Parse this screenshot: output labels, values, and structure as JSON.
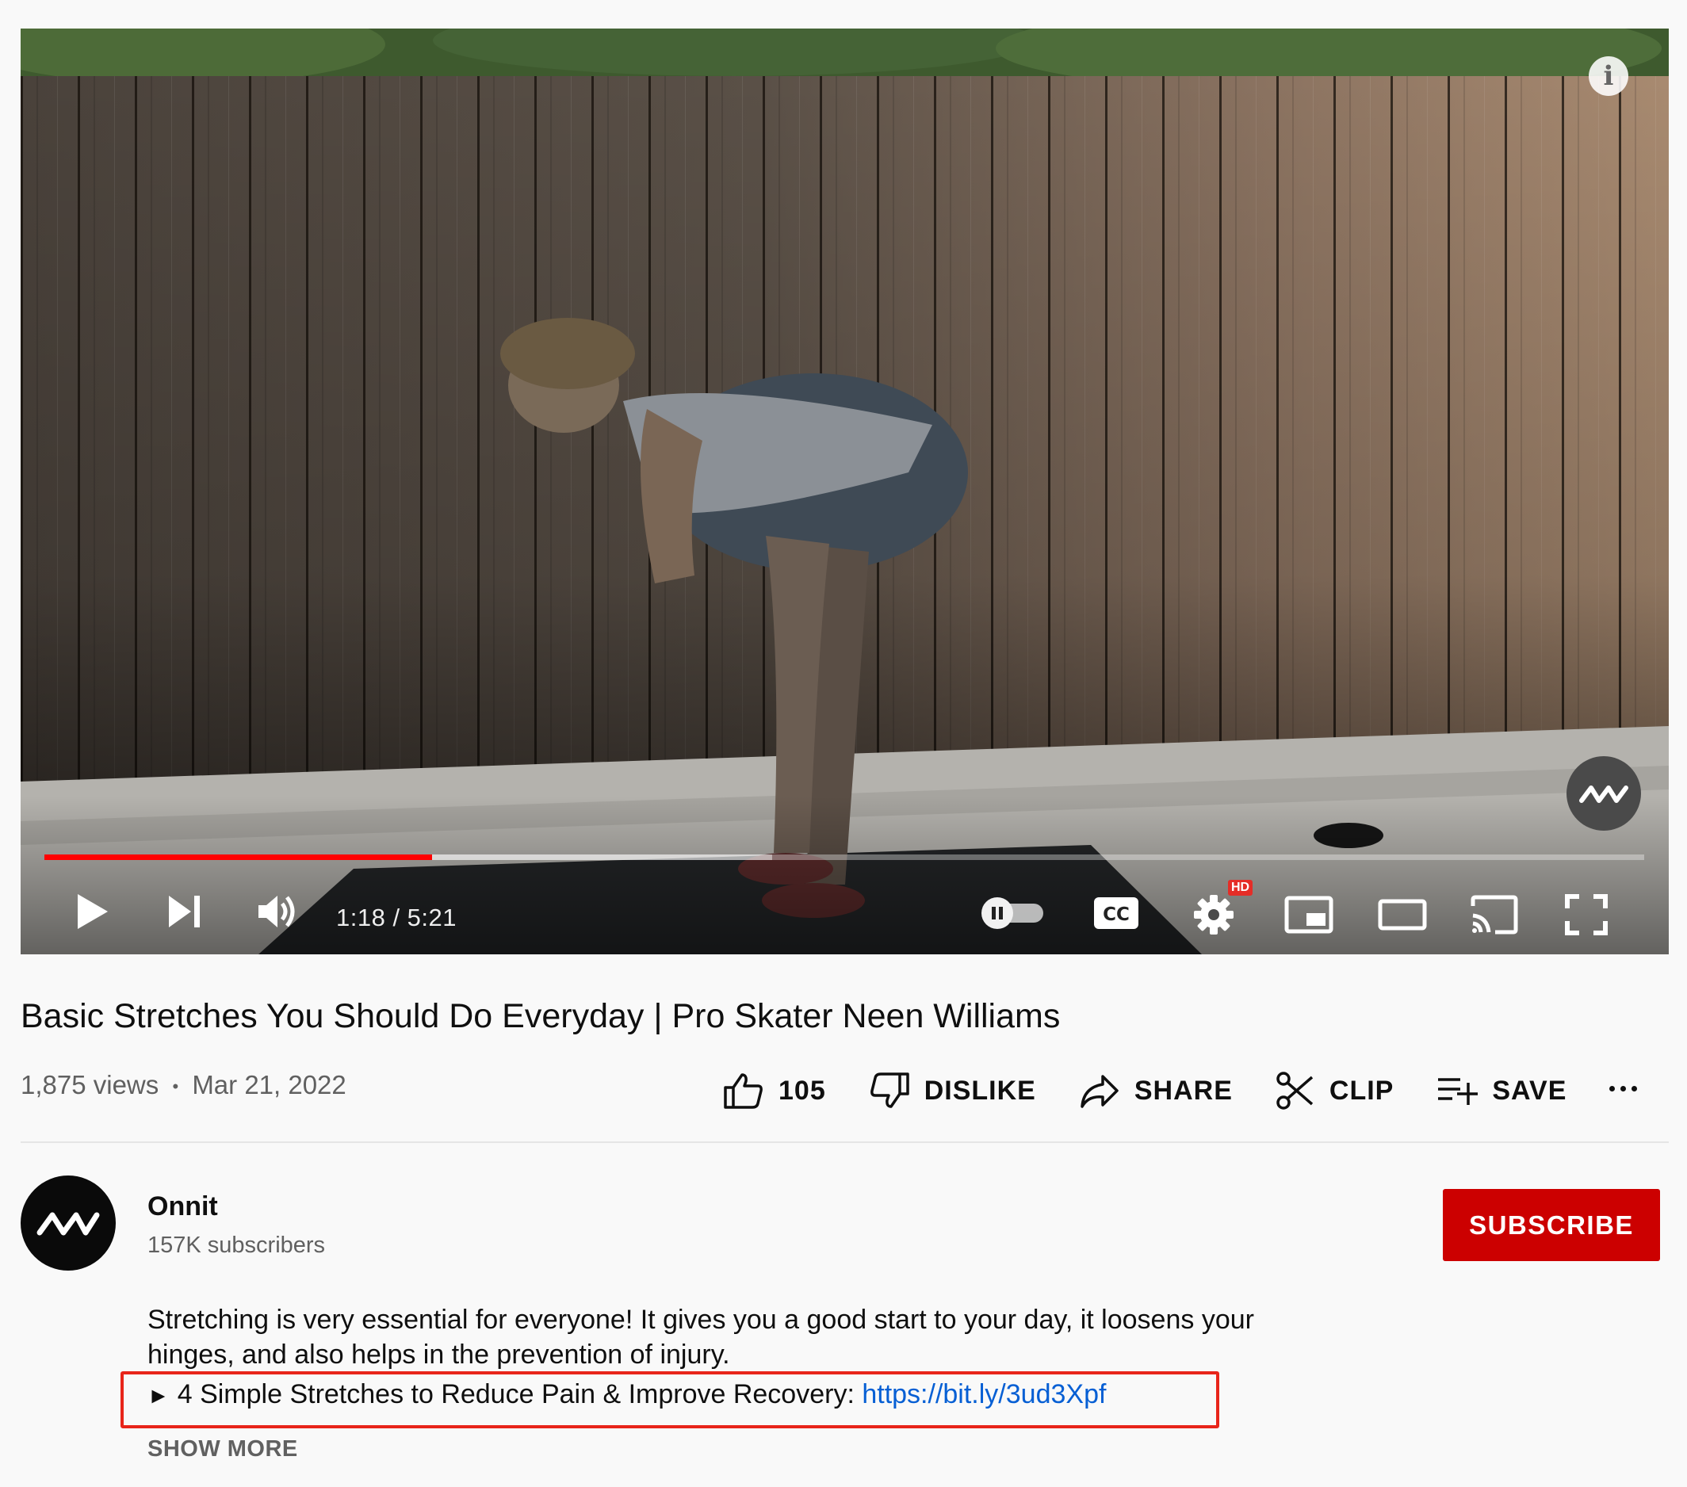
{
  "player": {
    "time_display": "1:18 / 5:21",
    "progress_played": 0.2425,
    "progress_loaded": 0.455,
    "autoplay_enabled": false,
    "quality_badge": "HD",
    "info_icon": "info-icon",
    "colors": {
      "progress": "#ff0000",
      "badge": "#e52d27"
    }
  },
  "video": {
    "title": "Basic Stretches You Should Do Everyday | Pro Skater Neen Williams",
    "views": "1,875 views",
    "separator": "•",
    "date": "Mar 21, 2022"
  },
  "actions": {
    "like_count": "105",
    "dislike_label": "DISLIKE",
    "share_label": "SHARE",
    "clip_label": "CLIP",
    "save_label": "SAVE"
  },
  "channel": {
    "name": "Onnit",
    "subscribers": "157K subscribers",
    "subscribe_label": "SUBSCRIBE",
    "subscribe_color": "#cc0000"
  },
  "description": {
    "line1": "Stretching is very essential for everyone!  It gives you a good start to your day, it loosens your",
    "line2": "hinges, and also helps in the prevention of injury.",
    "bullet": "►",
    "link_text": "4 Simple Stretches to Reduce Pain & Improve Recovery: ",
    "link_url": "https://bit.ly/3ud3Xpf",
    "link_color": "#065fd4",
    "show_more": "SHOW MORE",
    "highlight_color": "#e8251a"
  }
}
